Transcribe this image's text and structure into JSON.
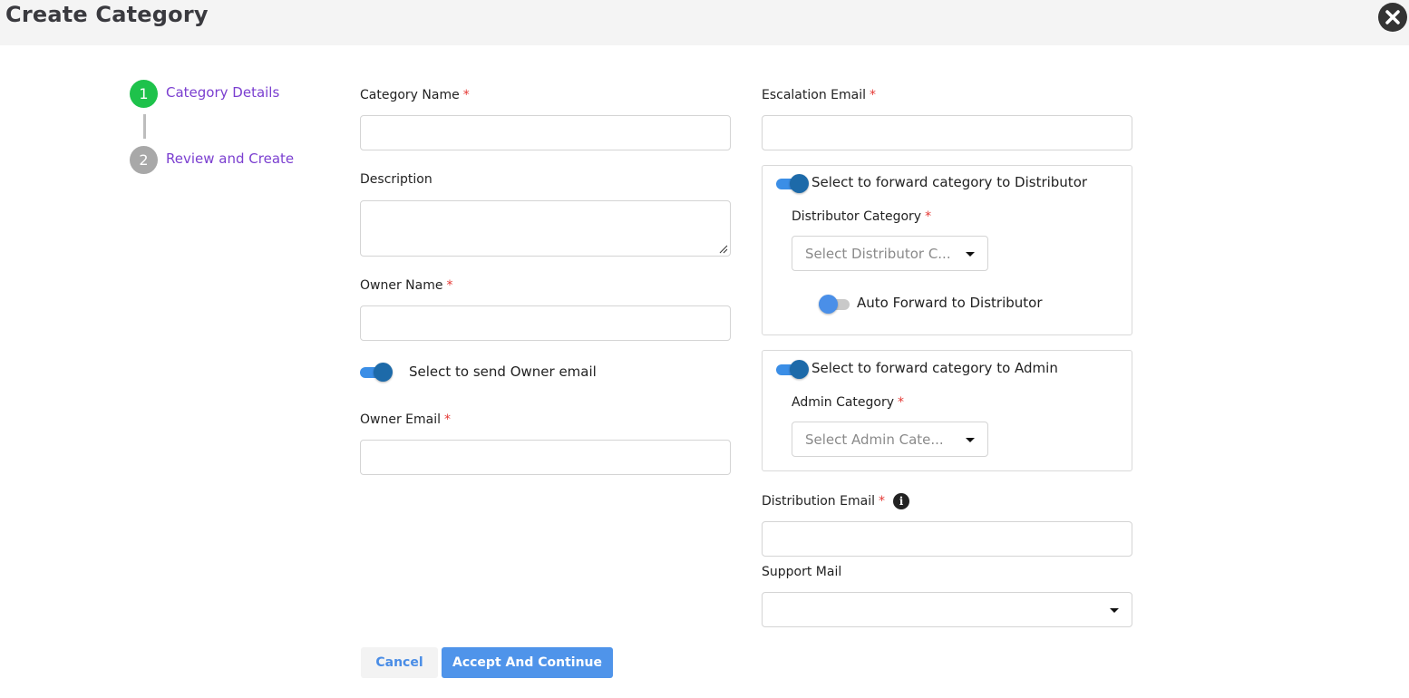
{
  "header": {
    "title": "Create Category"
  },
  "stepper": {
    "steps": [
      {
        "number": "1",
        "label": "Category Details",
        "color": "#1ec24b"
      },
      {
        "number": "2",
        "label": "Review and Create",
        "color": "#a8a8a8"
      }
    ]
  },
  "form": {
    "required_mark": "*",
    "category_name": {
      "label": "Category Name",
      "value": ""
    },
    "description": {
      "label": "Description",
      "value": ""
    },
    "owner_name": {
      "label": "Owner Name",
      "value": ""
    },
    "send_owner_email": {
      "label": "Select to send Owner email",
      "on": true
    },
    "owner_email": {
      "label": "Owner Email",
      "value": ""
    },
    "escalation_email": {
      "label": "Escalation Email",
      "value": ""
    },
    "distributor_panel": {
      "toggle_label": "Select to forward category to Distributor",
      "toggle_on": true,
      "category_label": "Distributor Category",
      "category_placeholder": "Select Distributor C...",
      "auto_forward_label": "Auto Forward to Distributor",
      "auto_forward_on": false
    },
    "admin_panel": {
      "toggle_label": "Select to forward category to Admin",
      "toggle_on": true,
      "category_label": "Admin Category",
      "category_placeholder": "Select Admin Cate..."
    },
    "distribution_email": {
      "label": "Distribution Email",
      "value": "",
      "info_icon": "info-icon"
    },
    "support_mail": {
      "label": "Support Mail",
      "value": ""
    }
  },
  "actions": {
    "cancel": "Cancel",
    "accept": "Accept And Continue"
  },
  "colors": {
    "accent": "#4f94ea",
    "step_label": "#7b3fd0",
    "required": "#e53935"
  }
}
